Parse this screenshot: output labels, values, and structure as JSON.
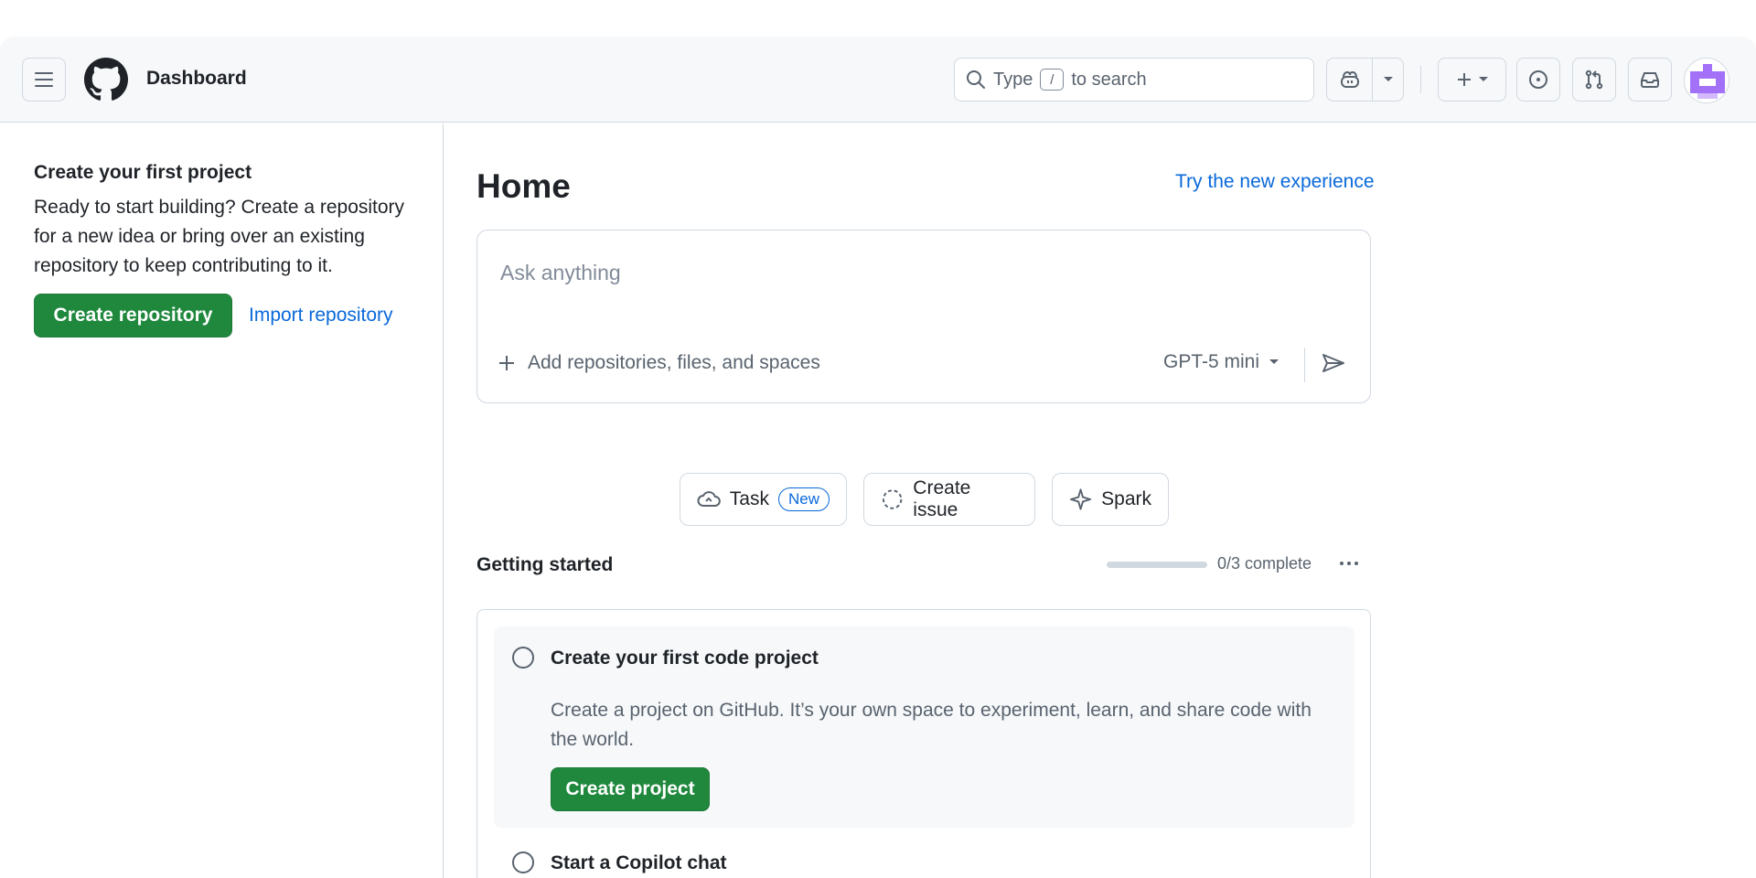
{
  "header": {
    "title": "Dashboard",
    "search": {
      "prefix": "Type",
      "key": "/",
      "suffix": "to search"
    }
  },
  "sidebar": {
    "title": "Create your first project",
    "description": "Ready to start building? Create a repository for a new idea or bring over an existing repository to keep contributing to it.",
    "create_button": "Create repository",
    "import_link": "Import repository"
  },
  "main": {
    "title": "Home",
    "try_new": "Try the new experience",
    "ask": {
      "placeholder": "Ask anything",
      "add_label": "Add repositories, files, and spaces",
      "model": "GPT-5 mini"
    },
    "actions": {
      "task": "Task",
      "task_badge": "New",
      "create_issue": "Create issue",
      "spark": "Spark"
    },
    "getting_started": {
      "title": "Getting started",
      "progress_text": "0/3 complete",
      "progress_fraction": 0,
      "tasks": [
        {
          "title": "Create your first code project",
          "description": "Create a project on GitHub. It’s your own space to experiment, learn, and share code with the world.",
          "button": "Create project"
        },
        {
          "title": "Start a Copilot chat"
        }
      ]
    }
  },
  "colors": {
    "primary_green": "#1f883d",
    "link_blue": "#0969da",
    "header_bg": "#f6f8fa"
  }
}
